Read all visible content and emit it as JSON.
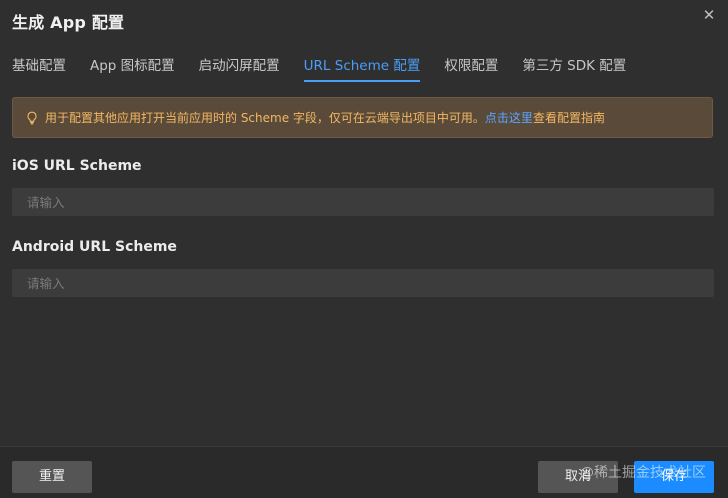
{
  "dialog": {
    "title": "生成 App 配置",
    "close_icon": "close-icon"
  },
  "tabs": [
    {
      "label": "基础配置",
      "active": false
    },
    {
      "label": "App 图标配置",
      "active": false
    },
    {
      "label": "启动闪屏配置",
      "active": false
    },
    {
      "label": "URL Scheme 配置",
      "active": true
    },
    {
      "label": "权限配置",
      "active": false
    },
    {
      "label": "第三方 SDK 配置",
      "active": false
    }
  ],
  "notice": {
    "icon": "lightbulb-icon",
    "text": "用于配置其他应用打开当前应用时的 Scheme 字段，仅可在云端导出项目中可用。",
    "link_text": "点击这里",
    "after_link_text": "查看配置指南"
  },
  "fields": {
    "ios": {
      "label": "iOS URL Scheme",
      "value": "",
      "placeholder": "请输入"
    },
    "android": {
      "label": "Android URL Scheme",
      "value": "",
      "placeholder": "请输入"
    }
  },
  "footer": {
    "reset_label": "重置",
    "cancel_label": "取消",
    "save_label": "保存"
  },
  "watermark": "@稀土掘金技术社区",
  "colors": {
    "background": "#2f2f2f",
    "accent": "#4a9ef7",
    "primary_button": "#1a8cff",
    "notice_bg": "#5a4a3a",
    "notice_text": "#f3b863",
    "link": "#5aa6ff"
  }
}
